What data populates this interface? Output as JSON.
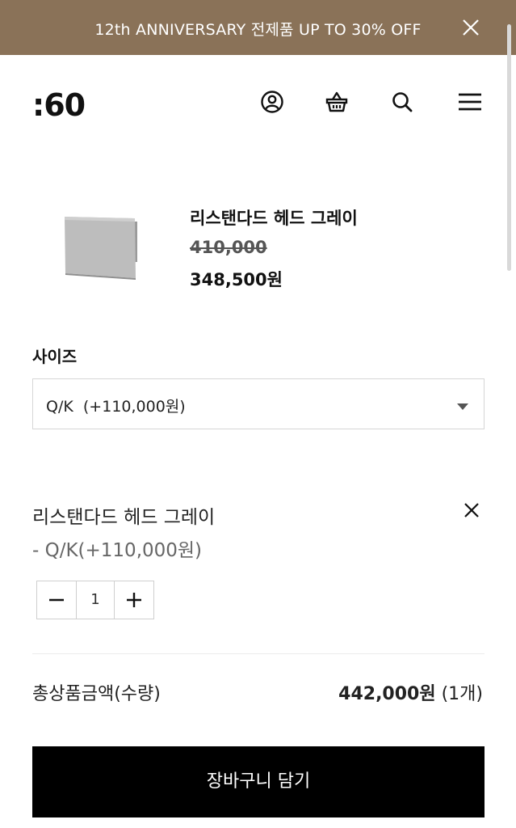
{
  "banner": {
    "text": "12th ANNIVERSARY 전제품 UP TO 30% OFF",
    "background": "#8a7258",
    "close_icon": "close-icon"
  },
  "header": {
    "logo": ":60",
    "icons": [
      "account-icon",
      "basket-icon",
      "search-icon",
      "menu-icon"
    ]
  },
  "product": {
    "name": "리스탠다드 헤드 그레이",
    "original_price": "410,000",
    "sale_price": "348,500원"
  },
  "size": {
    "label": "사이즈",
    "selected": "Q/K  (+110,000원)"
  },
  "selection": {
    "name": "리스탠다드 헤드 그레이",
    "option": "- Q/K(+110,000원)",
    "quantity": "1"
  },
  "total": {
    "label": "총상품금액(수량)",
    "amount": "442,000원",
    "count": "(1개)"
  },
  "cta": {
    "label": "장바구니 담기"
  }
}
